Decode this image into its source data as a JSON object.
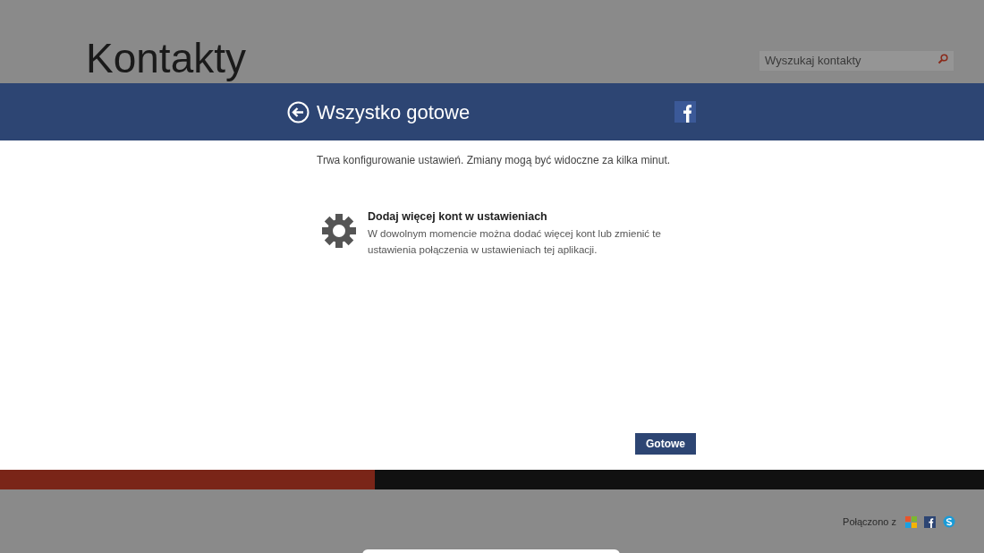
{
  "app_title": "Kontakty",
  "search": {
    "placeholder": "Wyszukaj kontakty"
  },
  "dialog": {
    "title": "Wszystko gotowe",
    "message": "Trwa konfigurowanie ustawień. Zmiany mogą być widoczne za kilka minut.",
    "tip": {
      "heading": "Dodaj więcej kont w ustawieniach",
      "text": "W dowolnym momencie można dodać więcej kont lub zmienić te ustawienia połączenia w ustawieniach tej aplikacji."
    },
    "button": "Gotowe"
  },
  "status": {
    "label": "Połączono z"
  }
}
